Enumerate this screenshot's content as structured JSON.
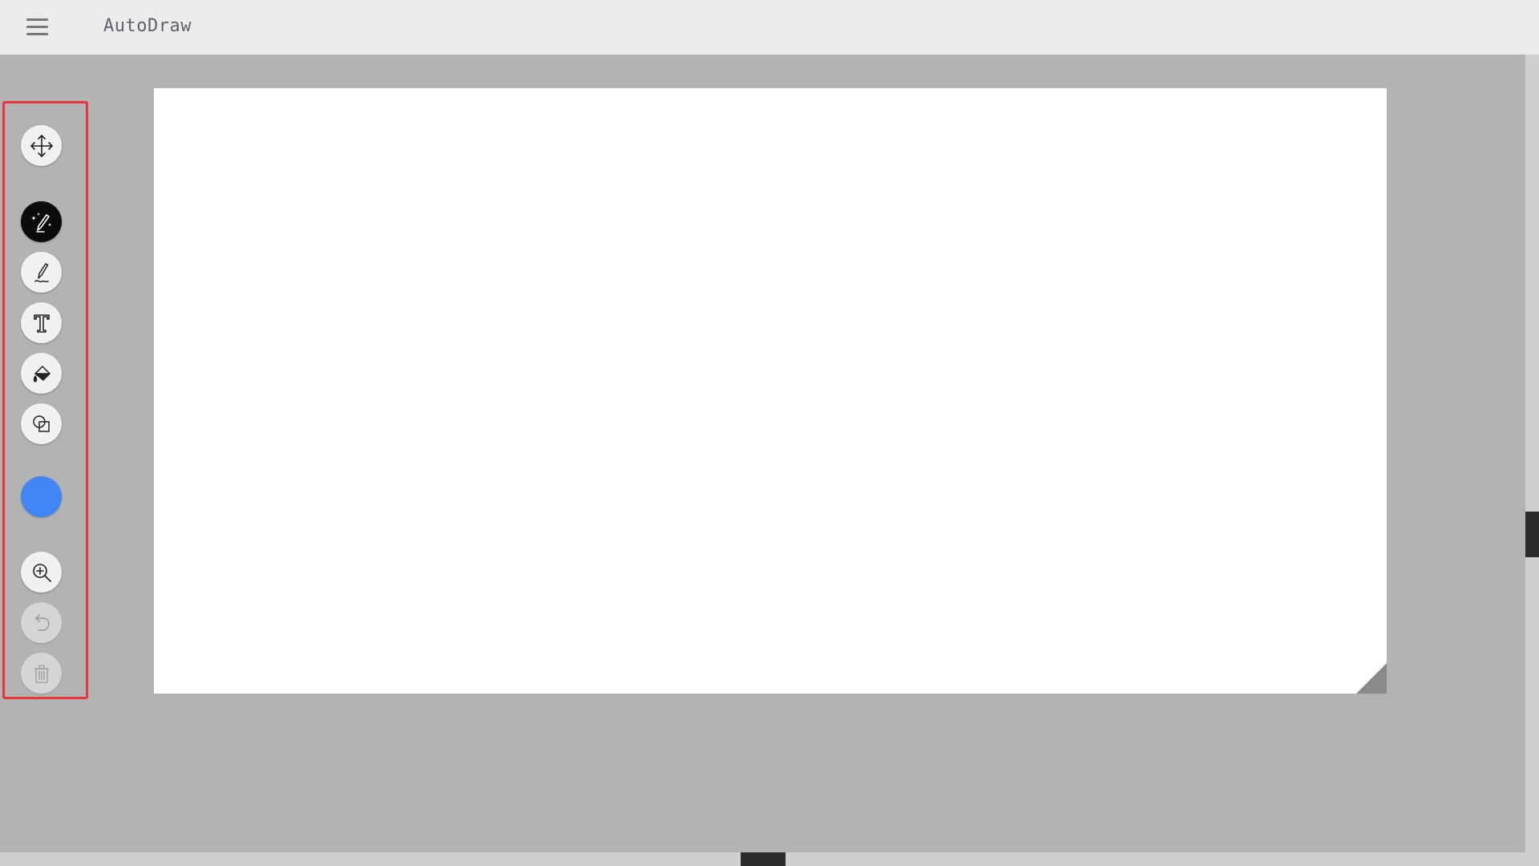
{
  "header": {
    "title": "AutoDraw",
    "menu_icon": "hamburger-menu-icon"
  },
  "toolbar": {
    "tools": [
      {
        "name": "select-tool",
        "icon": "move-arrows-icon",
        "state": "normal"
      },
      {
        "name": "autodraw-tool",
        "icon": "magic-pen-icon",
        "state": "active"
      },
      {
        "name": "draw-tool",
        "icon": "pen-icon",
        "state": "normal"
      },
      {
        "name": "type-tool",
        "icon": "text-icon",
        "state": "normal"
      },
      {
        "name": "fill-tool",
        "icon": "paint-bucket-icon",
        "state": "normal"
      },
      {
        "name": "shape-tool",
        "icon": "shapes-icon",
        "state": "normal"
      },
      {
        "name": "color-tool",
        "icon": "color-swatch",
        "state": "normal"
      },
      {
        "name": "zoom-tool",
        "icon": "zoom-in-icon",
        "state": "normal"
      },
      {
        "name": "undo-tool",
        "icon": "undo-icon",
        "state": "disabled"
      },
      {
        "name": "delete-tool",
        "icon": "trash-icon",
        "state": "disabled"
      }
    ],
    "highlight_color": "#e8343b"
  },
  "colors": {
    "selected_color": "#4285f4",
    "workspace_bg": "#b3b3b3",
    "header_bg": "#ececee",
    "canvas_bg": "#ffffff"
  }
}
